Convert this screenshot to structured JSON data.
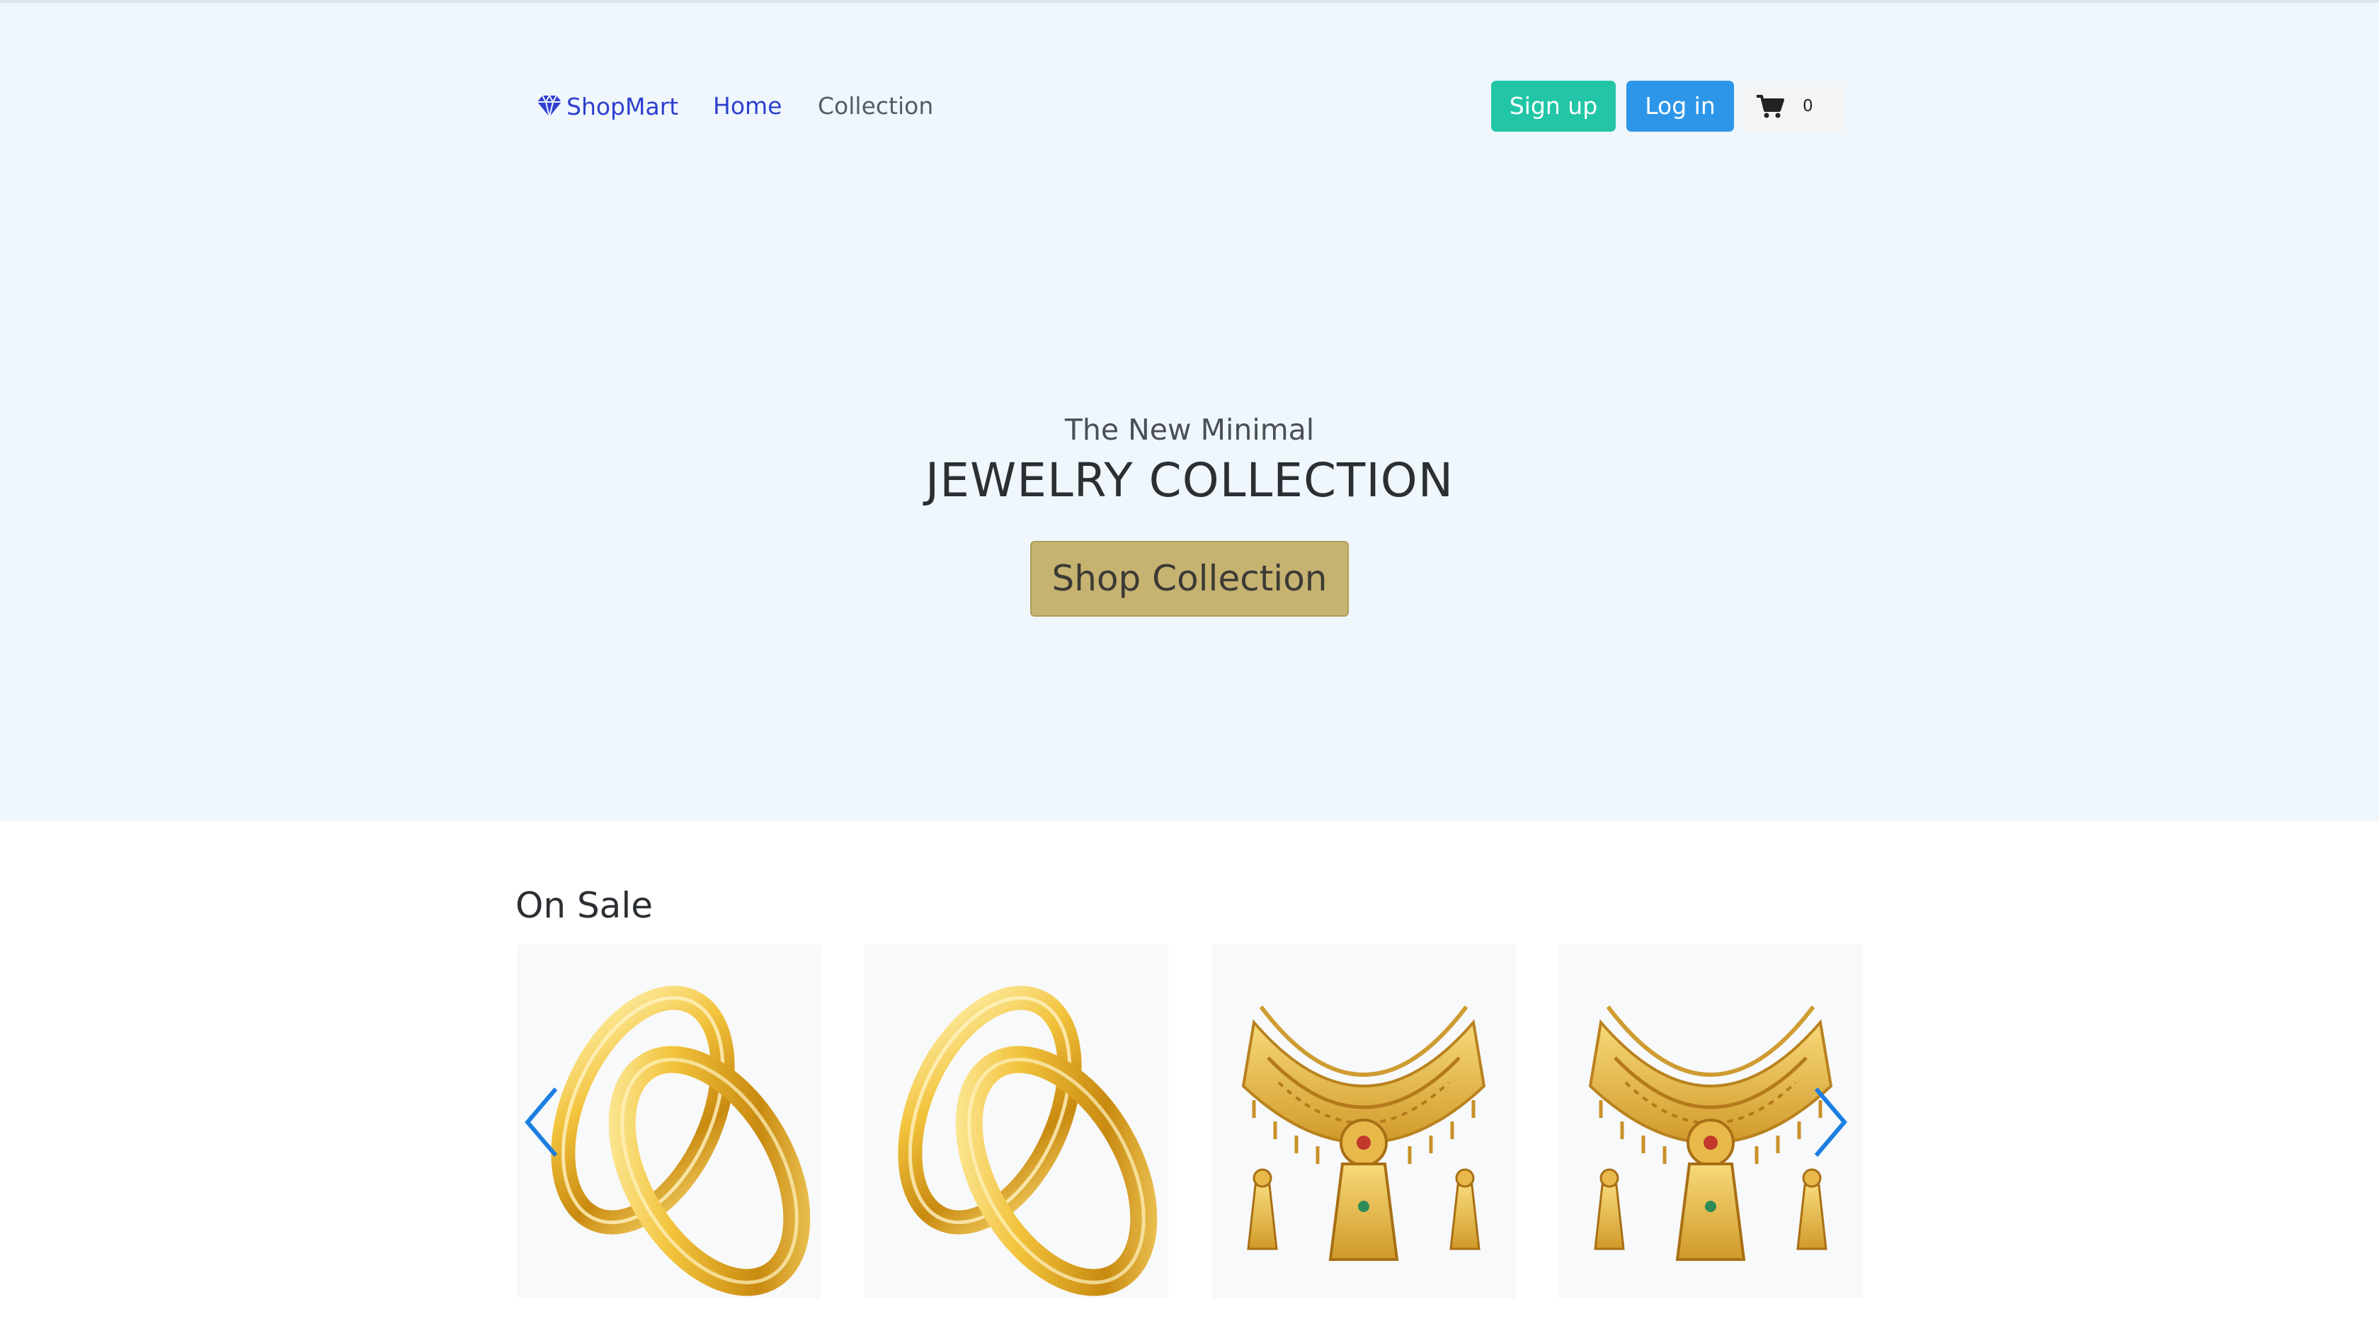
{
  "nav": {
    "brand": "ShopMart",
    "home": "Home",
    "collection": "Collection",
    "signup": "Sign up",
    "login": "Log in",
    "cart_count": "0"
  },
  "hero": {
    "subtitle": "The New Minimal",
    "title": "JEWELRY COLLECTION",
    "cta": "Shop Collection"
  },
  "sale": {
    "title": "On Sale",
    "products": [
      {
        "image": "gold-rings"
      },
      {
        "image": "gold-rings"
      },
      {
        "image": "gold-necklace-set"
      },
      {
        "image": "gold-necklace-set"
      }
    ]
  },
  "colors": {
    "hero_bg": "#eff7fd",
    "brand": "#2f3fd0",
    "signup": "#22c6a6",
    "login": "#2d96e8",
    "cta": "#c6b371",
    "arrow": "#1d7fe0"
  },
  "icons": {
    "brand": "diamond-icon",
    "cart": "cart-icon",
    "prev": "chevron-left-icon",
    "next": "chevron-right-icon"
  }
}
